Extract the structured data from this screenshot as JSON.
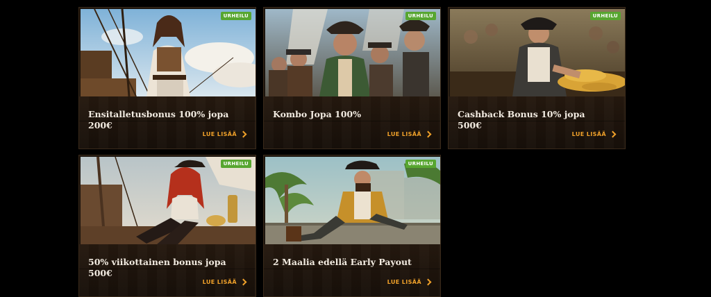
{
  "cards": [
    {
      "badge": "URHEILU",
      "title": "Ensitalletusbonus 100% jopa 200€",
      "more": "LUE LISÄÄ",
      "image": "female-pirate-on-ship-deck"
    },
    {
      "badge": "URHEILU",
      "title": "Kombo Jopa 100%",
      "more": "LUE LISÄÄ",
      "image": "pirate-crew-group"
    },
    {
      "badge": "URHEILU",
      "title": "Cashback Bonus 10% jopa 500€",
      "more": "LUE LISÄÄ",
      "image": "pirate-with-gold-coins"
    },
    {
      "badge": "URHEILU",
      "title": "50% viikottainen bonus jopa 500€",
      "more": "LUE LISÄÄ",
      "image": "red-haired-pirate-woman-seated"
    },
    {
      "badge": "URHEILU",
      "title": "2 Maalia edellä Early Payout",
      "more": "LUE LISÄÄ",
      "image": "pirate-captain-lounging-tropical"
    }
  ],
  "colors": {
    "badge": "#57a630",
    "link": "#f0a12a",
    "card_bg": "#1c140d",
    "page_bg": "#000000"
  }
}
